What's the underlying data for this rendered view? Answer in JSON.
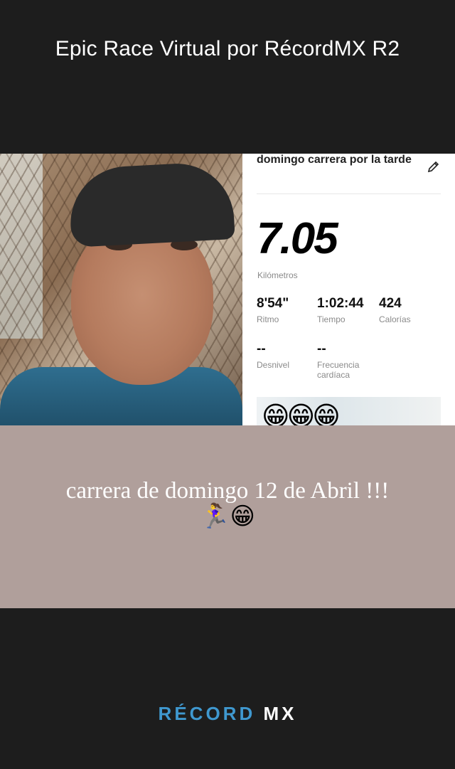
{
  "header": {
    "title": "Epic Race Virtual por RécordMX R2"
  },
  "activity": {
    "title": "domingo carrera por la tarde",
    "distance": "7.05",
    "distance_unit": "Kilómetros",
    "stats": [
      {
        "value": "8'54\"",
        "label": "Ritmo"
      },
      {
        "value": "1:02:44",
        "label": "Tiempo"
      },
      {
        "value": "424",
        "label": "Calorías"
      },
      {
        "value": "--",
        "label": "Desnivel"
      },
      {
        "value": "--",
        "label": "Frecuencia cardíaca"
      }
    ]
  },
  "overlay_emojis": "😁😁😁",
  "caption": {
    "text": "carrera de domingo 12 de Abril !!!",
    "emoji_line": "🏃‍♀️😁"
  },
  "brand": {
    "part1": "RÉCORD",
    "part2": "MX"
  },
  "colors": {
    "banner": "#b09f9b",
    "brand_blue": "#3f98cf",
    "background": "#1d1d1d"
  },
  "icons": [
    "pencil-icon"
  ]
}
